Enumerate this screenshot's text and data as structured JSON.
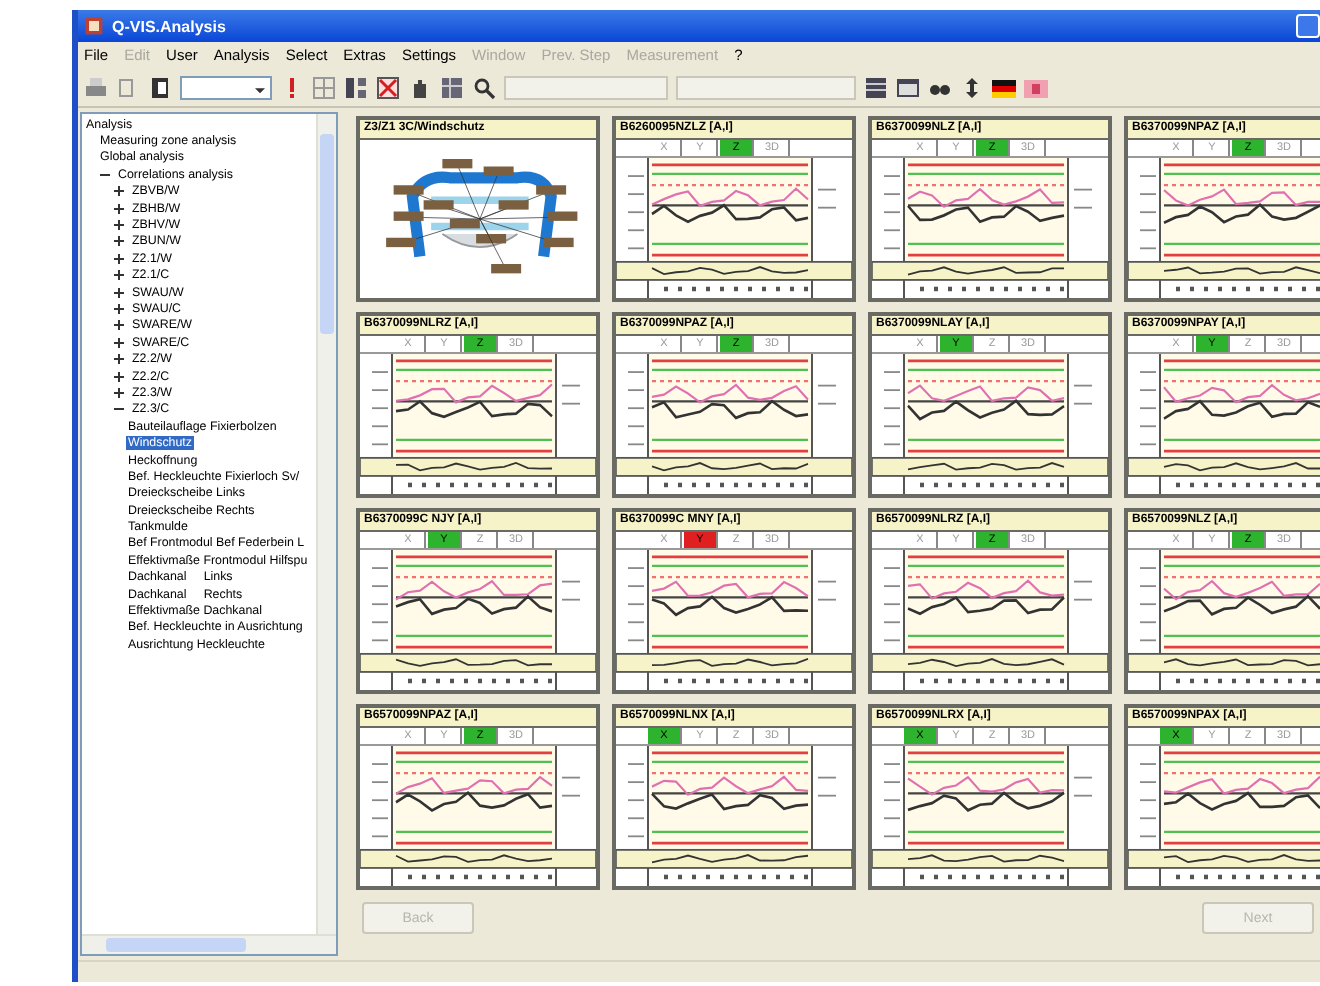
{
  "window": {
    "title": "Q-VIS.Analysis"
  },
  "menu": [
    {
      "label": "File",
      "disabled": false
    },
    {
      "label": "Edit",
      "disabled": true
    },
    {
      "label": "User",
      "disabled": false
    },
    {
      "label": "Analysis",
      "disabled": false
    },
    {
      "label": "Select",
      "disabled": false
    },
    {
      "label": "Extras",
      "disabled": false
    },
    {
      "label": "Settings",
      "disabled": false
    },
    {
      "label": "Window",
      "disabled": true
    },
    {
      "label": "Prev. Step",
      "disabled": true
    },
    {
      "label": "Measurement",
      "disabled": true
    },
    {
      "label": "?",
      "disabled": false
    }
  ],
  "tree": {
    "items": [
      {
        "label": "Analysis",
        "selected": false,
        "children": [
          {
            "label": "Measuring zone analysis",
            "selected": false
          },
          {
            "label": "Global analysis",
            "selected": false
          },
          {
            "label": "Correlations analysis",
            "selected": false,
            "expanded": true,
            "children": [
              {
                "label": "ZBVB/W",
                "selected": false,
                "expanded": false
              },
              {
                "label": "ZBHB/W",
                "selected": false,
                "expanded": false
              },
              {
                "label": "ZBHV/W",
                "selected": false,
                "expanded": false
              },
              {
                "label": "ZBUN/W",
                "selected": false,
                "expanded": false
              },
              {
                "label": "Z2.1/W",
                "selected": false,
                "expanded": false
              },
              {
                "label": "Z2.1/C",
                "selected": false,
                "expanded": false
              },
              {
                "label": "SWAU/W",
                "selected": false,
                "expanded": false
              },
              {
                "label": "SWAU/C",
                "selected": false,
                "expanded": false
              },
              {
                "label": "SWARE/W",
                "selected": false,
                "expanded": false
              },
              {
                "label": "SWARE/C",
                "selected": false,
                "expanded": false
              },
              {
                "label": "Z2.2/W",
                "selected": false,
                "expanded": false
              },
              {
                "label": "Z2.2/C",
                "selected": false,
                "expanded": false
              },
              {
                "label": "Z2.3/W",
                "selected": false,
                "expanded": false
              },
              {
                "label": "Z2.3/C",
                "selected": false,
                "expanded": true,
                "children": [
                  {
                    "label": "Bauteilauflage Fixierbolzen",
                    "selected": false
                  },
                  {
                    "label": "Windschutz",
                    "selected": true
                  },
                  {
                    "label": "Heckoffnung",
                    "selected": false
                  },
                  {
                    "label": "Bef. Heckleuchte Fixierloch Sv/",
                    "selected": false
                  },
                  {
                    "label": "Dreieckscheibe Links",
                    "selected": false
                  },
                  {
                    "label": "Dreieckscheibe Rechts",
                    "selected": false
                  },
                  {
                    "label": "Tankmulde",
                    "selected": false
                  },
                  {
                    "label": "Bef Frontmodul Bef Federbein L",
                    "selected": false
                  },
                  {
                    "label": "Effektivmaße Frontmodul Hilfspu",
                    "selected": false
                  },
                  {
                    "label": "Dachkanal     Links",
                    "selected": false
                  },
                  {
                    "label": "Dachkanal     Rechts",
                    "selected": false
                  },
                  {
                    "label": "Effektivmaße Dachkanal",
                    "selected": false
                  },
                  {
                    "label": "Bef. Heckleuchte in Ausrichtung",
                    "selected": false
                  },
                  {
                    "label": "Ausrichtung Heckleuchte",
                    "selected": false
                  }
                ]
              }
            ]
          }
        ]
      }
    ]
  },
  "cards": [
    {
      "kind": "image",
      "title": "Z3/Z1 3C/Windschutz"
    },
    {
      "kind": "chart",
      "title": "B6260095NZLZ [A,I]",
      "alarm": false,
      "axes": [
        {
          "label": "X",
          "selected": false
        },
        {
          "label": "Y",
          "selected": false
        },
        {
          "label": "Z",
          "selected": true
        },
        {
          "label": "3D",
          "selected": false
        }
      ]
    },
    {
      "kind": "chart",
      "title": "B6370099NLZ [A,I]",
      "alarm": false,
      "axes": [
        {
          "label": "X",
          "selected": false
        },
        {
          "label": "Y",
          "selected": false
        },
        {
          "label": "Z",
          "selected": true
        },
        {
          "label": "3D",
          "selected": false
        }
      ]
    },
    {
      "kind": "chart",
      "title": "B6370099NPAZ [A,I]",
      "alarm": false,
      "axes": [
        {
          "label": "X",
          "selected": false
        },
        {
          "label": "Y",
          "selected": false
        },
        {
          "label": "Z",
          "selected": true
        },
        {
          "label": "3D",
          "selected": false
        }
      ]
    },
    {
      "kind": "chart",
      "title": "B6370099NLRZ [A,I]",
      "alarm": false,
      "axes": [
        {
          "label": "X",
          "selected": false
        },
        {
          "label": "Y",
          "selected": false
        },
        {
          "label": "Z",
          "selected": true
        },
        {
          "label": "3D",
          "selected": false
        }
      ]
    },
    {
      "kind": "chart",
      "title": "B6370099NPAZ [A,I]",
      "alarm": false,
      "axes": [
        {
          "label": "X",
          "selected": false
        },
        {
          "label": "Y",
          "selected": false
        },
        {
          "label": "Z",
          "selected": true
        },
        {
          "label": "3D",
          "selected": false
        }
      ]
    },
    {
      "kind": "chart",
      "title": "B6370099NLAY [A,I]",
      "alarm": false,
      "axes": [
        {
          "label": "X",
          "selected": false
        },
        {
          "label": "Y",
          "selected": true
        },
        {
          "label": "Z",
          "selected": false
        },
        {
          "label": "3D",
          "selected": false
        }
      ]
    },
    {
      "kind": "chart",
      "title": "B6370099NPAY [A,I]",
      "alarm": false,
      "axes": [
        {
          "label": "X",
          "selected": false
        },
        {
          "label": "Y",
          "selected": true
        },
        {
          "label": "Z",
          "selected": false
        },
        {
          "label": "3D",
          "selected": false
        }
      ]
    },
    {
      "kind": "chart",
      "title": "B6370099C NJY [A,I]",
      "alarm": false,
      "axes": [
        {
          "label": "X",
          "selected": false
        },
        {
          "label": "Y",
          "selected": true
        },
        {
          "label": "Z",
          "selected": false
        },
        {
          "label": "3D",
          "selected": false
        }
      ]
    },
    {
      "kind": "chart",
      "title": "B6370099C MNY [A,I]",
      "alarm": true,
      "axes": [
        {
          "label": "X",
          "selected": false
        },
        {
          "label": "Y",
          "selected": true
        },
        {
          "label": "Z",
          "selected": false
        },
        {
          "label": "3D",
          "selected": false
        }
      ]
    },
    {
      "kind": "chart",
      "title": "B6570099NLRZ [A,I]",
      "alarm": false,
      "axes": [
        {
          "label": "X",
          "selected": false
        },
        {
          "label": "Y",
          "selected": false
        },
        {
          "label": "Z",
          "selected": true
        },
        {
          "label": "3D",
          "selected": false
        }
      ]
    },
    {
      "kind": "chart",
      "title": "B6570099NLZ [A,I]",
      "alarm": false,
      "axes": [
        {
          "label": "X",
          "selected": false
        },
        {
          "label": "Y",
          "selected": false
        },
        {
          "label": "Z",
          "selected": true
        },
        {
          "label": "3D",
          "selected": false
        }
      ]
    },
    {
      "kind": "chart",
      "title": "B6570099NPAZ [A,I]",
      "alarm": false,
      "axes": [
        {
          "label": "X",
          "selected": false
        },
        {
          "label": "Y",
          "selected": false
        },
        {
          "label": "Z",
          "selected": true
        },
        {
          "label": "3D",
          "selected": false
        }
      ]
    },
    {
      "kind": "chart",
      "title": "B6570099NLNX [A,I]",
      "alarm": false,
      "axes": [
        {
          "label": "X",
          "selected": true
        },
        {
          "label": "Y",
          "selected": false
        },
        {
          "label": "Z",
          "selected": false
        },
        {
          "label": "3D",
          "selected": false
        }
      ]
    },
    {
      "kind": "chart",
      "title": "B6570099NLRX [A,I]",
      "alarm": false,
      "axes": [
        {
          "label": "X",
          "selected": true
        },
        {
          "label": "Y",
          "selected": false
        },
        {
          "label": "Z",
          "selected": false
        },
        {
          "label": "3D",
          "selected": false
        }
      ]
    },
    {
      "kind": "chart",
      "title": "B6570099NPAX [A,I]",
      "alarm": false,
      "axes": [
        {
          "label": "X",
          "selected": true
        },
        {
          "label": "Y",
          "selected": false
        },
        {
          "label": "Z",
          "selected": false
        },
        {
          "label": "3D",
          "selected": false
        }
      ]
    }
  ],
  "buttons": [
    {
      "label": "Back",
      "disabled": true
    },
    {
      "label": "Next",
      "disabled": true
    }
  ]
}
